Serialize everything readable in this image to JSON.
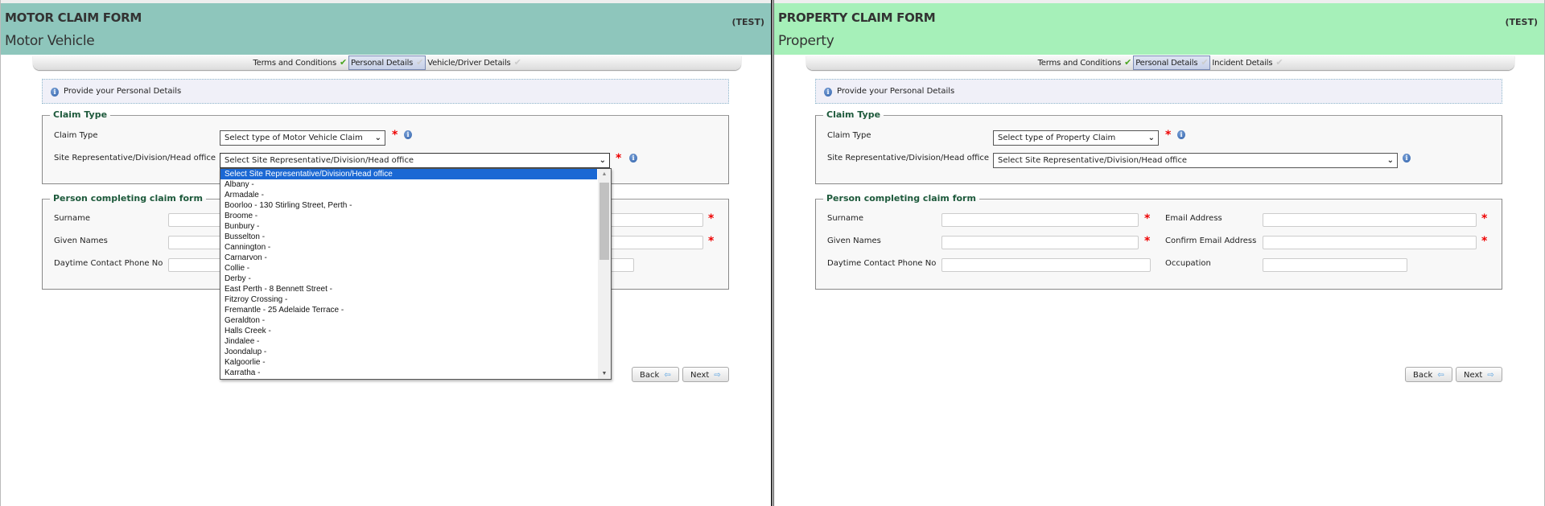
{
  "motor": {
    "header": {
      "title": "MOTOR CLAIM FORM",
      "subtitle": "Motor Vehicle",
      "env": "(TEST)",
      "color": "#8ec6bc"
    },
    "steps": [
      {
        "label": "Terms and Conditions",
        "state": "done"
      },
      {
        "label": "Personal Details",
        "state": "active"
      },
      {
        "label": "Vehicle/Driver Details",
        "state": "todo"
      }
    ],
    "info": "Provide your Personal Details",
    "claim_type_section": {
      "legend": "Claim Type",
      "claim_type_label": "Claim Type",
      "claim_type_value": "Select type of Motor Vehicle Claim",
      "site_label": "Site Representative/Division/Head office",
      "site_value": "Select Site Representative/Division/Head office"
    },
    "site_options": [
      "Select Site Representative/Division/Head office",
      "Albany -",
      "Armadale -",
      "Boorloo - 130 Stirling Street, Perth -",
      "Broome -",
      "Bunbury -",
      "Busselton -",
      "Cannington -",
      "Carnarvon -",
      "Collie -",
      "Derby -",
      "East Perth - 8 Bennett Street -",
      "Fitzroy Crossing -",
      "Fremantle - 25 Adelaide Terrace -",
      "Geraldton -",
      "Halls Creek -",
      "Jindalee -",
      "Joondalup -",
      "Kalgoorlie -",
      "Karratha -"
    ],
    "person_section": {
      "legend": "Person completing claim form",
      "surname": "Surname",
      "given_names": "Given Names",
      "phone": "Daytime Contact Phone No"
    },
    "buttons": {
      "back": "Back",
      "next": "Next"
    }
  },
  "property": {
    "header": {
      "title": "PROPERTY CLAIM FORM",
      "subtitle": "Property",
      "env": "(TEST)",
      "color": "#a6f0b9"
    },
    "steps": [
      {
        "label": "Terms and Conditions",
        "state": "done"
      },
      {
        "label": "Personal Details",
        "state": "active"
      },
      {
        "label": "Incident Details",
        "state": "todo"
      }
    ],
    "info": "Provide your Personal Details",
    "claim_type_section": {
      "legend": "Claim Type",
      "claim_type_label": "Claim Type",
      "claim_type_value": "Select type of Property Claim",
      "site_label": "Site Representative/Division/Head office",
      "site_value": "Select Site Representative/Division/Head office"
    },
    "person_section": {
      "legend": "Person completing claim form",
      "surname": "Surname",
      "given_names": "Given Names",
      "phone": "Daytime Contact Phone No",
      "email": "Email Address",
      "confirm_email": "Confirm Email Address",
      "occupation": "Occupation"
    },
    "buttons": {
      "back": "Back",
      "next": "Next"
    }
  },
  "icons": {
    "info": "i",
    "required": "*",
    "check": "✔",
    "chevron": "⌄",
    "arrow_left": "⇦",
    "arrow_right": "⇨"
  }
}
